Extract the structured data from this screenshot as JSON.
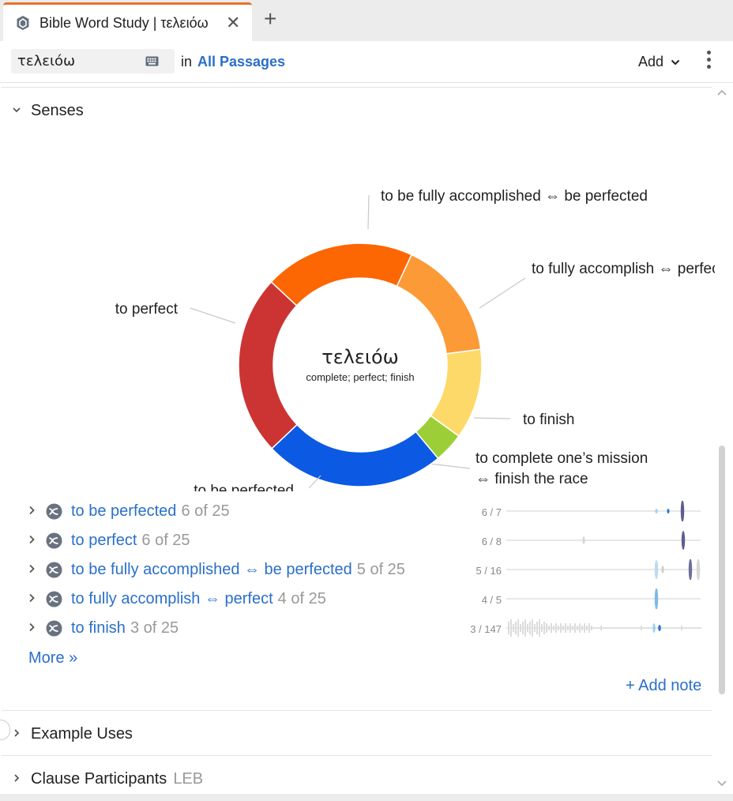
{
  "tab": {
    "title": "Bible Word Study | τελειόω",
    "close": "✕",
    "add": "+"
  },
  "toolbar": {
    "search_value": "τελειόω",
    "in_label": "in",
    "passages": "All Passages",
    "add_label": "Add"
  },
  "sections": {
    "senses": "Senses",
    "example_uses": "Example Uses",
    "clause_participants": "Clause Participants",
    "clause_participants_sub": "LEB"
  },
  "chart_data": {
    "type": "pie",
    "donut": true,
    "center_title": "τελειόω",
    "center_subtitle": "complete; perfect; finish",
    "slices": [
      {
        "label": "to be fully accomplished ⇔ be perfected",
        "value": 5,
        "color": "#fc6603"
      },
      {
        "label": "to fully accomplish ⇔ perfect",
        "value": 4,
        "color": "#fc9a37"
      },
      {
        "label": "to finish",
        "value": 3,
        "color": "#fdd969"
      },
      {
        "label": "to complete one’s mission ⇔ finish the race",
        "value": 1,
        "color": "#9ccf37"
      },
      {
        "label": "to be perfected",
        "value": 6,
        "color": "#0c59e4"
      },
      {
        "label": "to perfect",
        "value": 6,
        "color": "#cc3434"
      }
    ]
  },
  "senses": [
    {
      "label": "to be perfected",
      "count": "6 of 25",
      "ratio": "6 / 7"
    },
    {
      "label": "to perfect",
      "count": "6 of 25",
      "ratio": "6 / 8"
    },
    {
      "label": "to be fully accomplished ⇔ be perfected",
      "count": "5 of 25",
      "ratio": "5 / 16"
    },
    {
      "label": "to fully accomplish ⇔ perfect",
      "count": "4 of 25",
      "ratio": "4 / 5"
    },
    {
      "label": "to finish",
      "count": "3 of 25",
      "ratio": "3 / 147"
    }
  ],
  "more_label": "More »",
  "add_note_label": "+ Add note"
}
